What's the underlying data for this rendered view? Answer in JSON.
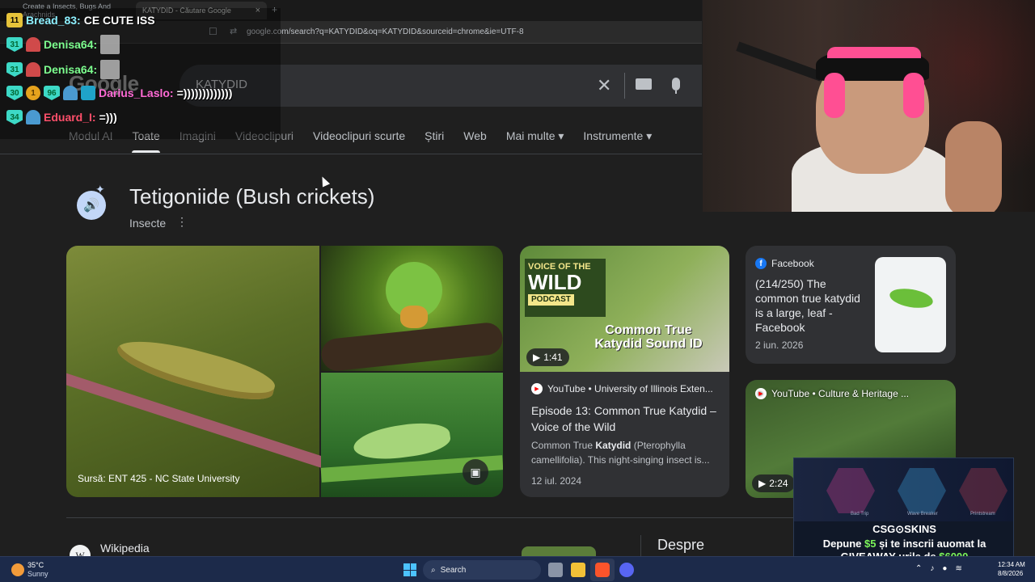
{
  "browser": {
    "tabs": [
      {
        "label": "Create a Insects, Bugs And Arachnids"
      },
      {
        "label": "KATYDID - Căutare Google",
        "close": "×"
      }
    ],
    "new_tab": "+",
    "url": "google.com/search?q=KATYDID&oq=KATYDID&sourceid=chrome&ie=UTF-8"
  },
  "search": {
    "logo": "Google",
    "query": "KATYDID",
    "clear": "✕",
    "tabs": [
      "Modul AI",
      "Toate",
      "Imagini",
      "Videoclipuri",
      "Videoclipuri scurte",
      "Știri",
      "Web",
      "Mai multe",
      "Instrumente"
    ],
    "active_tab": "Toate"
  },
  "entity": {
    "title": "Tetigoniide (Bush crickets)",
    "subtitle": "Insecte",
    "speaker": "🔊",
    "more": "⋮"
  },
  "images": {
    "source": "Sursă: ENT 425 - NC State University"
  },
  "video": {
    "brand_line1": "VOICE OF THE",
    "brand_line2": "WILD",
    "brand_line3": "PODCAST",
    "thumb_title": "Common True Katydid Sound ID",
    "duration": "1:41",
    "source": "YouTube • University of Illinois Exten...",
    "title": "Episode 13: Common True Katydid – Voice of the Wild",
    "desc_pre": "Common True ",
    "desc_bold": "Katydid",
    "desc_post": " (Pterophylla camellifolia). This night-singing insect is...",
    "date": "12 iul. 2024"
  },
  "facebook": {
    "source": "Facebook",
    "text": "(214/250) The common true katydid is a large, leaf - Facebook",
    "date": "2 iun. 2026"
  },
  "video2": {
    "source": "YouTube • Culture & Heritage ...",
    "duration": "2:24"
  },
  "bottom": {
    "wiki_label": "Wikipedia",
    "wiki_letter": "W",
    "despre": "Despre"
  },
  "chat": [
    {
      "badge": "11",
      "user": "Bread_83:",
      "user_color": "#8df0ff",
      "msg": "CE CUTE ISS"
    },
    {
      "badge": "31",
      "user": "Denisa64:",
      "user_color": "#7dff8f",
      "msg": ""
    },
    {
      "badge": "31",
      "user": "Denisa64:",
      "user_color": "#7dff8f",
      "msg": ""
    },
    {
      "badge": "30",
      "coin": "1",
      "extra": "96",
      "user": "Darius_Laslo:",
      "user_color": "#ff6ad5",
      "msg": "=)))))))))))))"
    },
    {
      "badge": "34",
      "user": "Eduard_I:",
      "user_color": "#ff4f6a",
      "msg": "=)))"
    }
  ],
  "ad": {
    "brand": "CSG⊙SKINS",
    "line1_pre": "Depune ",
    "line1_hl": "$5",
    "line1_post": " și te inscrii auomat la",
    "line2_pre": "GIVEAWAY-urile de ",
    "line2_hl": "$6000",
    "weapons": [
      "Bad Trip",
      "Wave Breaker",
      "Printstream"
    ]
  },
  "taskbar": {
    "temp": "35°C",
    "weather": "Sunny",
    "search": "Search",
    "time": "12:34 AM",
    "date": "8/8/2026"
  },
  "colors": {
    "page_bg": "#1f1f1f",
    "card_bg": "#303134",
    "accent_blue": "#c2d7f8",
    "taskbar": "#1c2a4a"
  }
}
